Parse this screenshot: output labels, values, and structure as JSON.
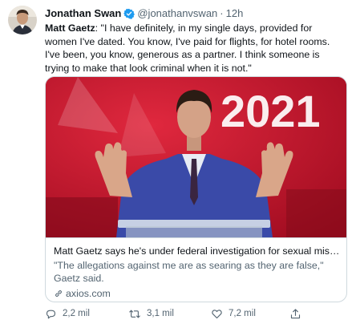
{
  "tweet": {
    "author_name": "Jonathan Swan",
    "handle": "@jonathanvswan",
    "separator": "·",
    "time": "12h",
    "speaker": "Matt Gaetz",
    "text": ": \"I have definitely, in my single days, provided for women I've dated. You know, I've paid for flights, for hotel rooms. I've been, you know, generous as a partner. I think someone is trying to make that look criminal when it is not.\""
  },
  "card": {
    "image_text": "2021",
    "title": "Matt Gaetz says he's under federal investigation for sexual misco…",
    "description": "\"The allegations against me are as searing as they are false,\" Gaetz said.",
    "domain": "axios.com"
  },
  "actions": {
    "replies": "2,2 mil",
    "retweets": "3,1 mil",
    "likes": "7,2 mil"
  },
  "colors": {
    "verified": "#1d9bf0",
    "stage_red": "#c5142b",
    "suit_blue": "#3a4aa8"
  },
  "icons": {
    "verified": "verified-badge-icon",
    "link": "link-icon",
    "reply": "reply-icon",
    "retweet": "retweet-icon",
    "like": "heart-icon",
    "share": "share-icon"
  }
}
